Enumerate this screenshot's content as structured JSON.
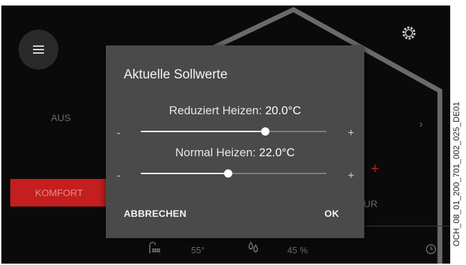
{
  "background": {
    "mode_off_label": "AUS",
    "mode_comfort_label": "KOMFORT",
    "partial_label": "UR",
    "bottom_bar": {
      "hot_water_temp": "55°",
      "humidity": "45 %"
    }
  },
  "dialog": {
    "title": "Aktuelle Sollwerte",
    "setpoints": [
      {
        "label": "Reduziert Heizen:",
        "value": "20.0°C",
        "level_percent": 67
      },
      {
        "label": "Normal Heizen:",
        "value": "22.0°C",
        "level_percent": 47
      }
    ],
    "minus_symbol": "-",
    "plus_symbol": "+",
    "cancel_label": "ABBRECHEN",
    "ok_label": "OK"
  },
  "side_label": "OCH_08_01_200_701_002_025_DE01",
  "colors": {
    "screen_background": "#0a0a0a",
    "dialog_background": "#4a4a4a",
    "accent_red": "#c41e1e"
  },
  "icons": [
    "menu-icon",
    "gear-icon",
    "radiator-icon",
    "humidity-drops-icon",
    "clock-icon"
  ]
}
